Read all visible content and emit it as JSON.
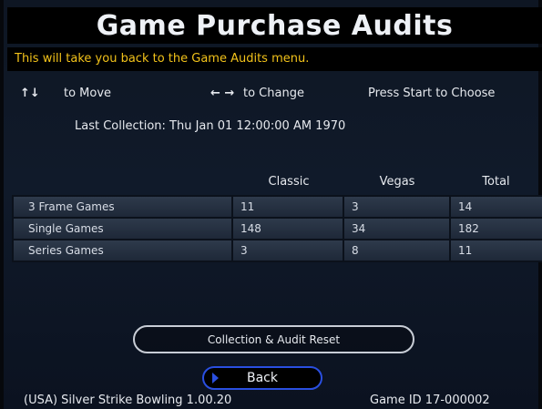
{
  "screen": {
    "title": "Game Purchase Audits",
    "info": "This will take you back to the Game Audits menu."
  },
  "controls": {
    "move_icon": "↑↓",
    "move_label": "to Move",
    "change_icon": "← →",
    "change_label": "to Change",
    "start_label": "Press Start to Choose"
  },
  "collection": {
    "text": "Last Collection: Thu Jan 01 12:00:00 AM 1970"
  },
  "table": {
    "columns": [
      "Classic",
      "Vegas",
      "Total"
    ],
    "rows": [
      {
        "label": "3 Frame Games",
        "classic": "11",
        "vegas": "3",
        "total": "14"
      },
      {
        "label": "Single Games",
        "classic": "148",
        "vegas": "34",
        "total": "182"
      },
      {
        "label": "Series Games",
        "classic": "3",
        "vegas": "8",
        "total": "11"
      }
    ]
  },
  "buttons": {
    "reset": "Collection & Audit Reset",
    "back": "Back"
  },
  "footer": {
    "version": "(USA) Silver Strike Bowling 1.00.20",
    "game_id": "Game ID 17-000002"
  },
  "colors": {
    "title_bar": "#000000",
    "info_text": "#f2c21a",
    "back_highlight": "#2a4fe0",
    "row_fill": "#2e3a4b"
  }
}
